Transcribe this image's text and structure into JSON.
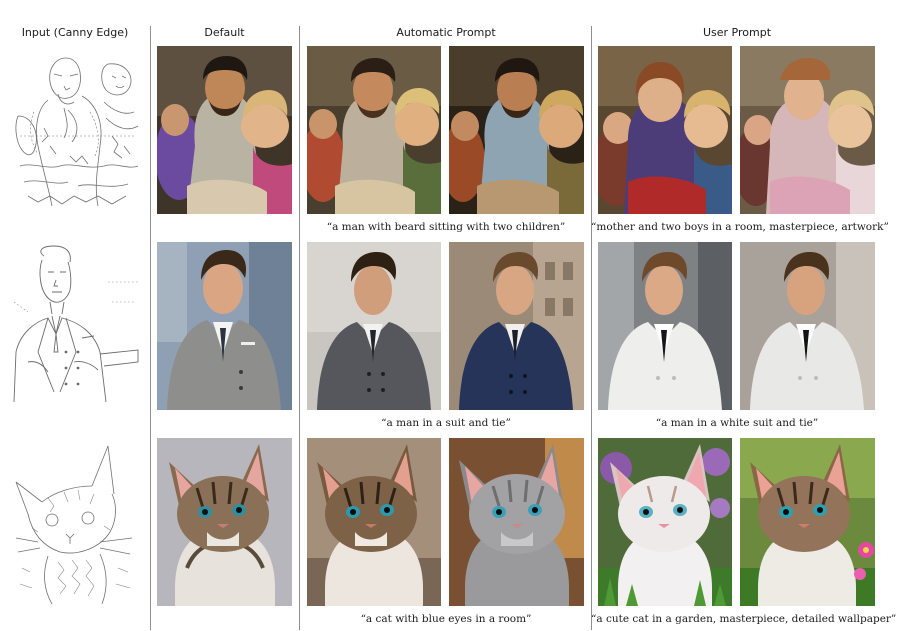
{
  "headers": {
    "input": "Input (Canny Edge)",
    "default": "Default",
    "automatic": "Automatic Prompt",
    "user": "User Prompt"
  },
  "captions": {
    "row1_auto": "“a man with beard sitting with two children”",
    "row1_user": "“mother and two boys in a room, masterpiece, artwork”",
    "row2_auto": "“a man in a suit and tie”",
    "row2_user": "“a man in a white suit and tie”",
    "row3_auto": "“a cat with blue eyes in a room”",
    "row3_user": "“a cute cat in a garden, masterpiece, detailed wallpaper”"
  },
  "images": {
    "row1": [
      "canny edge map of a man seated with two children",
      "painted man with beard and two children",
      "man with beard and two children",
      "man with beard and two children",
      "mother and two boys",
      "mother and two boys"
    ],
    "row2": [
      "canny edge map of a man in a suit",
      "man in grey suit and tie",
      "man in grey suit and tie",
      "man in navy suit and tie",
      "man in white suit and tie",
      "man in white suit and tie"
    ],
    "row3": [
      "canny edge map of a kitten",
      "tabby kitten with blue eyes",
      "tabby kitten with blue eyes",
      "grey cat with blue eyes",
      "white kitten in garden",
      "tabby kitten in garden with flowers"
    ]
  }
}
